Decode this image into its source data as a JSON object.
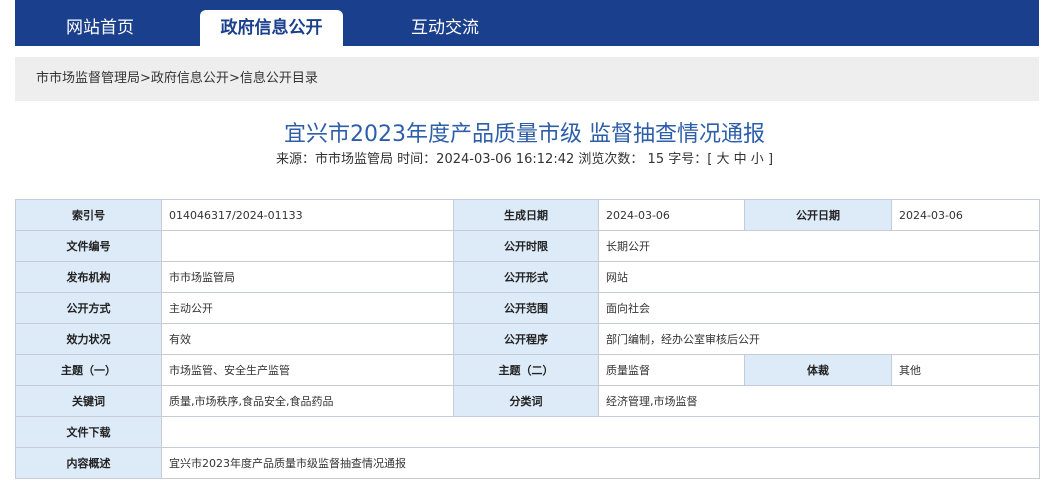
{
  "nav": {
    "tabs": [
      {
        "label": "网站首页"
      },
      {
        "label": "政府信息公开"
      },
      {
        "label": "互动交流"
      }
    ]
  },
  "breadcrumb": {
    "items": [
      "市市场监督管理局",
      "政府信息公开",
      "信息公开目录"
    ],
    "separator": ">"
  },
  "article": {
    "title": "宜兴市2023年度产品质量市级 监督抽查情况通报",
    "source_label": "来源：",
    "source": "市市场监管局",
    "time_label": "时间：",
    "time": "2024-03-06 16:12:42",
    "views_label": "浏览次数：",
    "views": "15",
    "font_label": "字号：",
    "font_open": "[",
    "font_large": "大",
    "font_medium": "中",
    "font_small": "小",
    "font_close": "]"
  },
  "info": {
    "index_label": "索引号",
    "index_value": "014046317/2024-01133",
    "gen_date_label": "生成日期",
    "gen_date_value": "2024-03-06",
    "pub_date_label": "公开日期",
    "pub_date_value": "2024-03-06",
    "doc_no_label": "文件编号",
    "doc_no_value": "",
    "pub_term_label": "公开时限",
    "pub_term_value": "长期公开",
    "publisher_label": "发布机构",
    "publisher_value": "市市场监管局",
    "pub_form_label": "公开形式",
    "pub_form_value": "网站",
    "pub_method_label": "公开方式",
    "pub_method_value": "主动公开",
    "pub_scope_label": "公开范围",
    "pub_scope_value": "面向社会",
    "validity_label": "效力状况",
    "validity_value": "有效",
    "procedure_label": "公开程序",
    "procedure_value": "部门编制，经办公室审核后公开",
    "topic1_label": "主题（一）",
    "topic1_value": "市场监管、安全生产监管",
    "topic2_label": "主题（二）",
    "topic2_value": "质量监督",
    "genre_label": "体裁",
    "genre_value": "其他",
    "keywords_label": "关键词",
    "keywords_value": "质量,市场秩序,食品安全,食品药品",
    "category_label": "分类词",
    "category_value": "经济管理,市场监督",
    "download_label": "文件下载",
    "download_value": "",
    "summary_label": "内容概述",
    "summary_value": "宜兴市2023年度产品质量市级监督抽查情况通报"
  },
  "colors": {
    "nav_bg": "#1a3f8c",
    "title": "#2d5ea9",
    "label_bg": "#ddeaf7",
    "crumb_bg": "#eeeeee"
  }
}
